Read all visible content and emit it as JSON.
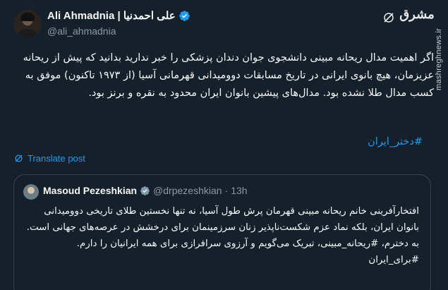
{
  "author": {
    "display_name": "Ali Ahmadnia | علی احمدنیا",
    "handle": "@ali_ahmadnia",
    "verified_icon": "verified-badge-icon",
    "avatar_icon": "avatar"
  },
  "watermark": {
    "text": "مشرق"
  },
  "side_url": "mashreghnews.ir",
  "tweet": {
    "text": "اگر اهمیت مدال ریحانه مبینی دانشجوی جوان دندان پزشکی را خبر ندارید بدانید که پیش از ریحانه عزیزمان، هیچ بانوی ایرانی در تاریخ مسابقات دوومیدانی قهرمانی آسیا (از ۱۹۷۳ تاکنون) موفق به کسب مدال طلا نشده بود. مدال‌های پیشین بانوان ایران محدود به نقره و برنز بود.",
    "hashtag": "#دختر_ایران"
  },
  "translate": {
    "label": "Translate post",
    "icon": "translate-icon"
  },
  "quote": {
    "display_name": "Masoud Pezeshkian",
    "handle": "@drpezeshkian",
    "separator": "·",
    "time": "13h",
    "verified_color": "#829aab",
    "paragraph1": "افتخارآفرینی خانم ریحانه مبینی قهرمان پرش طول آسیا، نه تنها نخستین طلای تاریخی دوومیدانی بانوان ایران، بلکه نماد عزم شکست‌ناپذیر زنان سرزمینمان برای درخشش در عرصه‌های جهانی است.",
    "paragraph2": "به دخترم، #ریحانه_مبینی، تبریک می‌گویم و آرزوی سرافرازی برای همه ایرانیان را دارم.",
    "paragraph3": "#برای_ایران"
  },
  "colors": {
    "background": "#15202b",
    "text": "#f7f9f9",
    "secondary": "#8b98a5",
    "accent": "#1d9bf0",
    "border": "#38444d"
  }
}
